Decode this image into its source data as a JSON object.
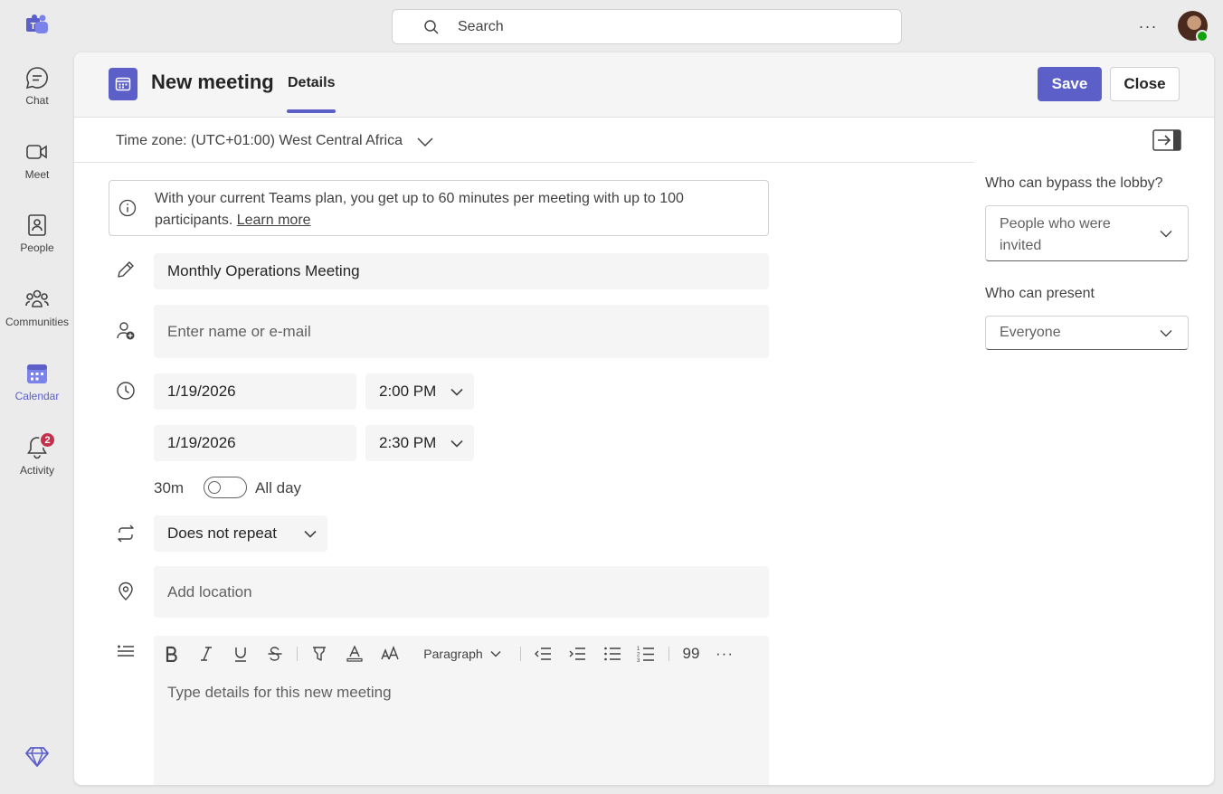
{
  "rail": {
    "items": [
      {
        "label": "Chat",
        "icon": "chat-icon"
      },
      {
        "label": "Meet",
        "icon": "video-icon"
      },
      {
        "label": "People",
        "icon": "contacts-icon"
      },
      {
        "label": "Communities",
        "icon": "communities-icon"
      },
      {
        "label": "Calendar",
        "icon": "calendar-icon",
        "active": true
      },
      {
        "label": "Activity",
        "icon": "bell-icon",
        "badge": "2"
      }
    ]
  },
  "topbar": {
    "search_placeholder": "Search",
    "more": "···"
  },
  "header": {
    "title": "New meeting",
    "tab": "Details",
    "save_label": "Save",
    "close_label": "Close"
  },
  "timezone": {
    "label": "Time zone: (UTC+01:00) West Central Africa"
  },
  "info": {
    "text": "With your current Teams plan, you get up to 60 minutes per meeting with up to 100 participants.",
    "link": "Learn more"
  },
  "form": {
    "title_value": "Monthly Operations Meeting",
    "attendees_placeholder": "Enter name or e-mail",
    "start_date": "1/19/2026",
    "start_time": "2:00 PM",
    "end_date": "1/19/2026",
    "end_time": "2:30 PM",
    "duration": "30m",
    "all_day_label": "All day",
    "repeat": "Does not repeat",
    "location_placeholder": "Add location"
  },
  "editor": {
    "paragraph_label": "Paragraph",
    "quote": "99",
    "more": "···",
    "placeholder": "Type details for this new meeting"
  },
  "side": {
    "lobby_label": "Who can bypass the lobby?",
    "lobby_value": "People who were invited",
    "present_label": "Who can present",
    "present_value": "Everyone"
  },
  "colors": {
    "accent": "#5b5fc7",
    "badge": "#c4314b",
    "presence": "#13a10e"
  }
}
